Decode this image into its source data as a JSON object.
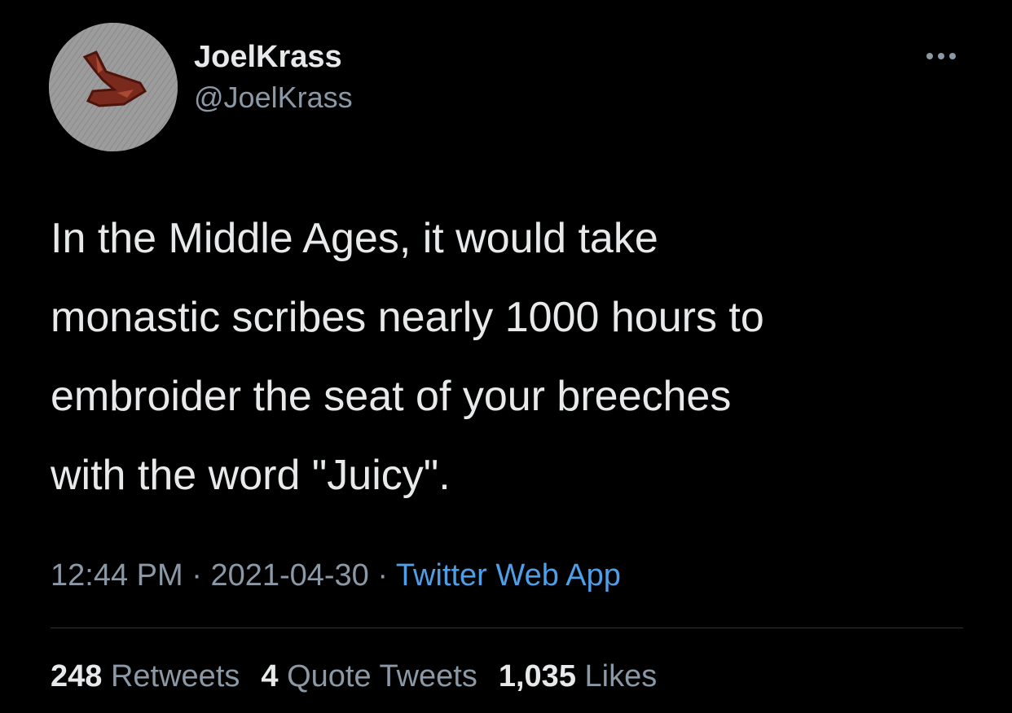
{
  "author": {
    "display_name": "JoelKrass",
    "handle": "@JoelKrass"
  },
  "tweet": {
    "lines": [
      "In the Middle Ages, it would take",
      "monastic scribes nearly 1000 hours to",
      "embroider the seat of your breeches",
      "with the word \"Juicy\"."
    ]
  },
  "meta": {
    "time": "12:44 PM",
    "separator": "·",
    "date": "2021-04-30",
    "source": "Twitter Web App"
  },
  "stats": {
    "retweets_count": "248",
    "retweets_label": "Retweets",
    "quotes_count": "4",
    "quotes_label": "Quote Tweets",
    "likes_count": "1,035",
    "likes_label": "Likes"
  },
  "colors": {
    "background": "#000000",
    "primary_text": "#e7e9ea",
    "secondary_text": "#8b98a5",
    "link": "#4f9ee8",
    "divider": "#2f3336"
  },
  "icons": {
    "more": "more-horizontal-icon"
  }
}
